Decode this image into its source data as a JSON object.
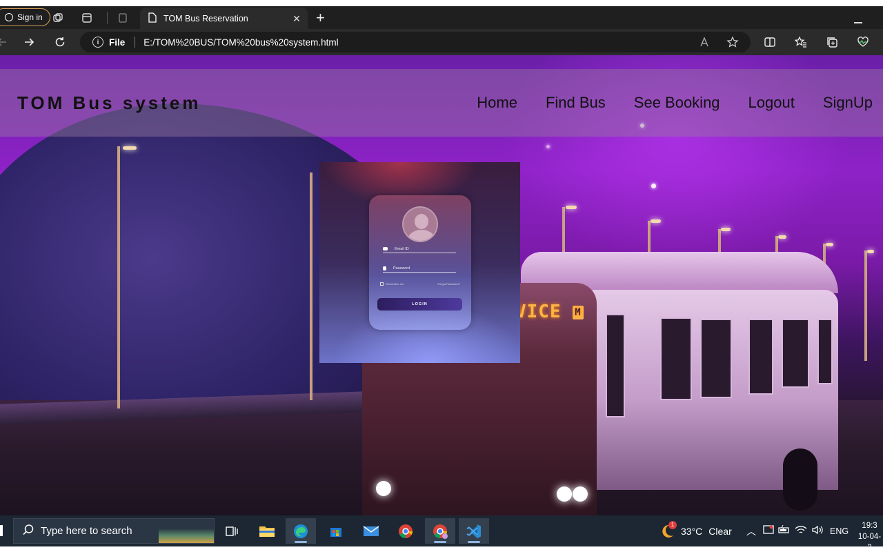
{
  "browser": {
    "signin_label": "Sign in",
    "tab_title": "TOM Bus Reservation",
    "close_glyph": "✕",
    "newtab_glyph": "+",
    "address": {
      "scheme_label": "File",
      "url": "E:/TOM%20BUS/TOM%20bus%20system.html"
    },
    "icons": {
      "back": "←",
      "forward": "→",
      "refresh": "↻",
      "read_aloud": "A",
      "favorite": "☆",
      "split": "▯",
      "favorites": "☆",
      "collections": "⧉",
      "heart": "♡"
    }
  },
  "site": {
    "brand": "TOM Bus system",
    "menu": [
      "Home",
      "Find Bus",
      "See Booking",
      "Logout",
      "SignUp"
    ],
    "destination_sign": "VICE",
    "destination_badge": "M"
  },
  "login": {
    "email_placeholder": "Email ID",
    "password_placeholder": "Password",
    "remember_label": "Remember me",
    "forgot_label": "Forgot Password?",
    "button_label": "LOGIN"
  },
  "taskbar": {
    "search_placeholder": "Type here to search",
    "weather_temp": "33°C",
    "weather_text": "Clear",
    "weather_badge": "1",
    "language": "ENG",
    "time": "19:3",
    "date": "10-04-2"
  },
  "colors": {
    "accent_tab_border": "#d9a15a",
    "taskbar": "#1c2733",
    "page_sky": "#8e22c7"
  }
}
